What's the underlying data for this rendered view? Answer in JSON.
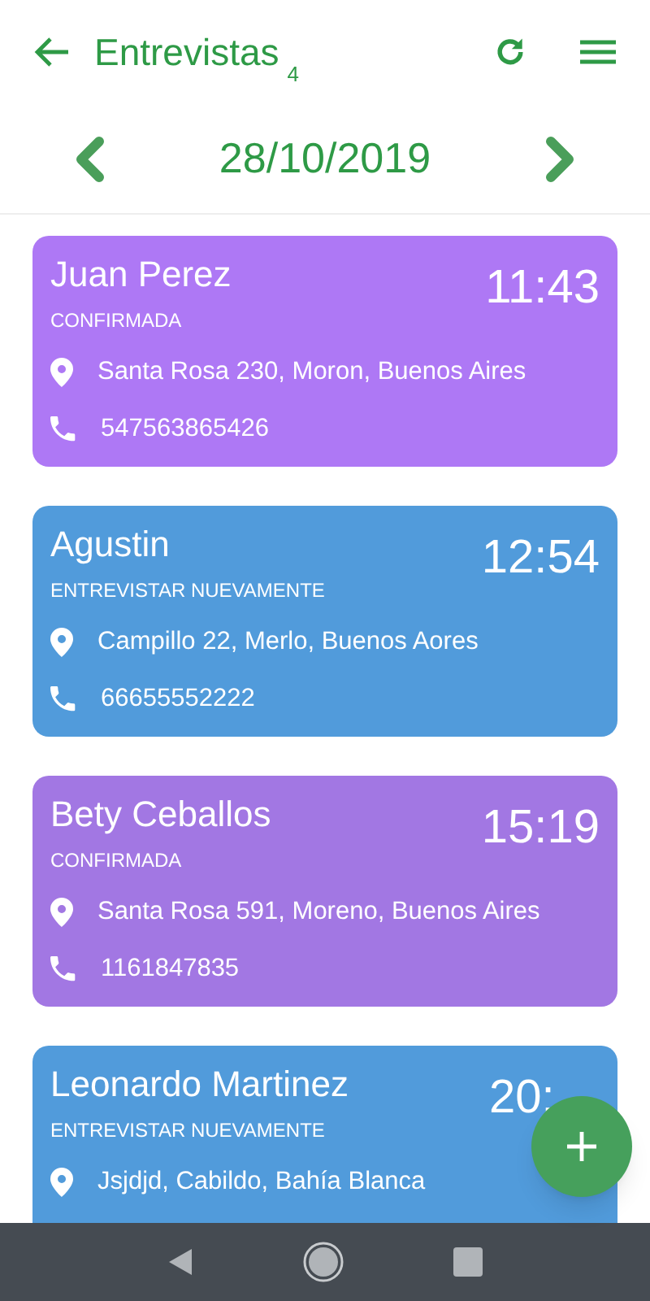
{
  "app_bar": {
    "title": "Entrevistas",
    "count": "4"
  },
  "date_nav": {
    "date": "28/10/2019"
  },
  "interviews": [
    {
      "name": "Juan Perez",
      "status": "CONFIRMADA",
      "time": "11:43",
      "address": "Santa Rosa 230, Moron, Buenos Aires",
      "phone": "547563865426",
      "color": "#ae78f5"
    },
    {
      "name": "Agustin",
      "status": "ENTREVISTAR NUEVAMENTE",
      "time": "12:54",
      "address": "Campillo 22, Merlo, Buenos Aores",
      "phone": "66655552222",
      "color": "#519bdb"
    },
    {
      "name": "Bety Ceballos",
      "status": "CONFIRMADA",
      "time": "15:19",
      "address": "Santa Rosa 591, Moreno, Buenos Aires",
      "phone": "1161847835",
      "color": "#a277e3"
    },
    {
      "name": "Leonardo Martinez",
      "status": "ENTREVISTAR NUEVAMENTE",
      "time": "20:",
      "address": "Jsjdjd, Cabildo, Bahía Blanca",
      "color": "#519bdb"
    }
  ]
}
